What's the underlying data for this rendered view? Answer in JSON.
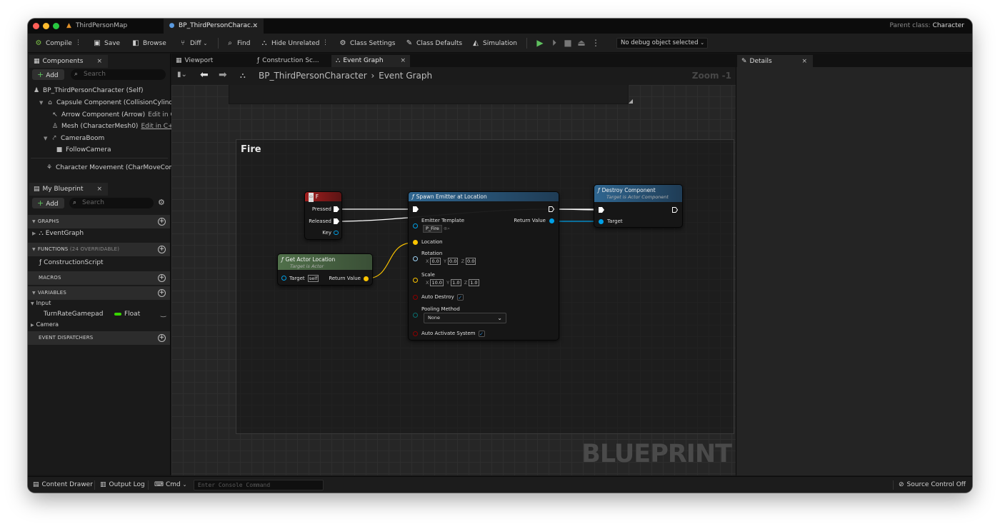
{
  "window": {
    "tabs": [
      {
        "label": "ThirdPersonMap",
        "icon": "ue-map-icon"
      },
      {
        "label": "BP_ThirdPersonCharac...",
        "icon": "character-blueprint-icon",
        "close": "×"
      }
    ],
    "parent_class_label": "Parent class:",
    "parent_class_value": "Character"
  },
  "toolbar": {
    "compile": "Compile",
    "save": "Save",
    "browse": "Browse",
    "diff": "Diff",
    "find": "Find",
    "hide_unrelated": "Hide Unrelated",
    "class_settings": "Class Settings",
    "class_defaults": "Class Defaults",
    "simulation": "Simulation",
    "debug_object": "No debug object selected"
  },
  "components": {
    "tab_label": "Components",
    "close": "×",
    "add_label": "Add",
    "search_placeholder": "Search",
    "items": [
      {
        "label": "BP_ThirdPersonCharacter (Self)"
      },
      {
        "label": "Capsule Component (CollisionCylinde"
      },
      {
        "label": "Arrow Component (Arrow)",
        "edit": "Edit in C"
      },
      {
        "label": "Mesh (CharacterMesh0)",
        "edit": "Edit in C++"
      },
      {
        "label": "CameraBoom"
      },
      {
        "label": "FollowCamera"
      },
      {
        "label": "Character Movement (CharMoveComp"
      }
    ]
  },
  "my_blueprint": {
    "tab_label": "My Blueprint",
    "close": "×",
    "add_label": "Add",
    "search_placeholder": "Search",
    "sections": {
      "graphs": "GRAPHS",
      "functions": "FUNCTIONS",
      "functions_sub": "(24 OVERRIDABLE)",
      "macros": "MACROS",
      "variables": "VARIABLES",
      "event_dispatchers": "EVENT DISPATCHERS"
    },
    "event_graph": "EventGraph",
    "construction_script": "ConstructionScript",
    "var_category_input": "Input",
    "var_name": "TurnRateGamepad",
    "var_type": "Float",
    "var_category_camera": "Camera"
  },
  "center_tabs": [
    {
      "label": "Viewport"
    },
    {
      "label": "Construction Sc..."
    },
    {
      "label": "Event Graph",
      "close": "×"
    }
  ],
  "breadcrumb": {
    "blueprint": "BP_ThirdPersonCharacter",
    "separator": "›",
    "graph": "Event Graph",
    "zoom": "Zoom -1"
  },
  "graph": {
    "comment_title": "Fire",
    "watermark": "BLUEPRINT",
    "node_f": {
      "title": "F",
      "pins": [
        "Pressed",
        "Released",
        "Key"
      ]
    },
    "node_get_loc": {
      "title": "Get Actor Location",
      "subtitle": "Target is Actor",
      "target": "Target",
      "self": "self",
      "return": "Return Value"
    },
    "node_spawn": {
      "title": "Spawn Emitter at Location",
      "emitter_template": "Emitter Template",
      "template_value": "P_Fire",
      "return": "Return Value",
      "location": "Location",
      "rotation": "Rotation",
      "rot_x": "0.0",
      "rot_y": "0.0",
      "rot_z": "0.0",
      "scale": "Scale",
      "scale_x": "10.0",
      "scale_y": "1.0",
      "scale_z": "1.0",
      "auto_destroy": "Auto Destroy",
      "pooling_method": "Pooling Method",
      "pooling_value": "None",
      "auto_activate": "Auto Activate System",
      "axis_x": "X",
      "axis_y": "Y",
      "axis_z": "Z"
    },
    "node_destroy": {
      "title": "Destroy Component",
      "subtitle": "Target is Actor Component",
      "target": "Target"
    }
  },
  "details": {
    "tab_label": "Details",
    "close": "×"
  },
  "statusbar": {
    "content_drawer": "Content Drawer",
    "output_log": "Output Log",
    "cmd": "Cmd",
    "console_placeholder": "Enter Console Command",
    "source_control": "Source Control Off"
  },
  "colors": {
    "accent_blue": "#2f8ad0",
    "exec_white": "#ffffff",
    "vector_yellow": "#fcc400",
    "object_blue": "#00a0e6",
    "float_green": "#38d500",
    "bool_red": "#8b0000",
    "pure_header_green": "#4d6d48",
    "func_header_blue": "#2a5a82",
    "event_header_red": "#8b1c1c"
  }
}
